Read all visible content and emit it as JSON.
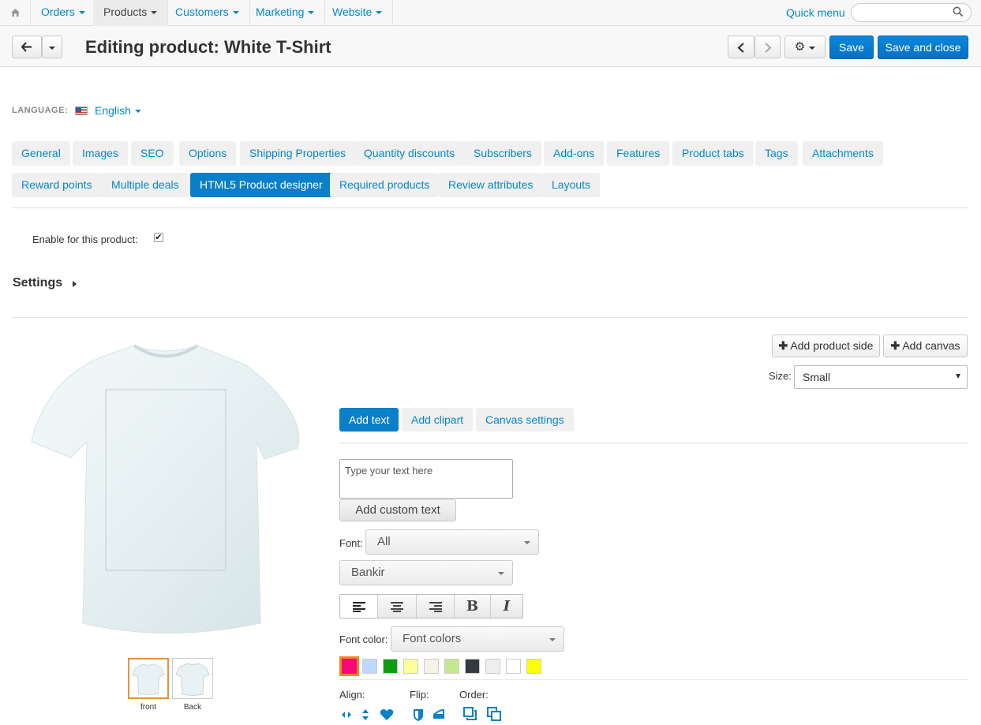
{
  "topnav": {
    "home_icon": "home-icon",
    "items": [
      {
        "label": "Orders"
      },
      {
        "label": "Products"
      },
      {
        "label": "Customers"
      },
      {
        "label": "Marketing"
      },
      {
        "label": "Website"
      }
    ],
    "quick_menu": "Quick menu",
    "search_placeholder": ""
  },
  "header": {
    "title": "Editing product: White T-Shirt",
    "save": "Save",
    "save_close": "Save and close"
  },
  "language": {
    "label": "LANGUAGE:",
    "value": "English"
  },
  "tabs_row1": [
    "General",
    "Images",
    "SEO",
    "Options",
    "Shipping Properties",
    "Quantity discounts",
    "Subscribers",
    "Add-ons",
    "Features",
    "Product tabs",
    "Tags",
    "Attachments"
  ],
  "tabs_row2": [
    "Reward points",
    "Multiple deals",
    "HTML5 Product designer",
    "Required products",
    "Review attributes",
    "Layouts"
  ],
  "active_tab": "HTML5 Product designer",
  "enable": {
    "label": "Enable for this product:",
    "checked": true
  },
  "settings": {
    "label": "Settings"
  },
  "designer": {
    "add_side": "Add product side",
    "add_canvas": "Add canvas",
    "size_label": "Size:",
    "size_value": "Small",
    "tabs": [
      "Add text",
      "Add clipart",
      "Canvas settings"
    ],
    "text_placeholder": "Type your text here",
    "add_custom_text": "Add custom text",
    "font_label": "Font:",
    "font_filter": "All",
    "font_name": "Bankir",
    "font_color_label": "Font color:",
    "font_colors": "Font colors",
    "swatches": [
      "#f7077a",
      "#bed8ff",
      "#0f9d10",
      "#ffff99",
      "#f5f3e8",
      "#c5e88f",
      "#333a40",
      "#eeeeee",
      "#ffffff",
      "#ffff00"
    ],
    "align_label": "Align:",
    "flip_label": "Flip:",
    "order_label": "Order:",
    "thumbs": [
      "front",
      "Back"
    ]
  }
}
